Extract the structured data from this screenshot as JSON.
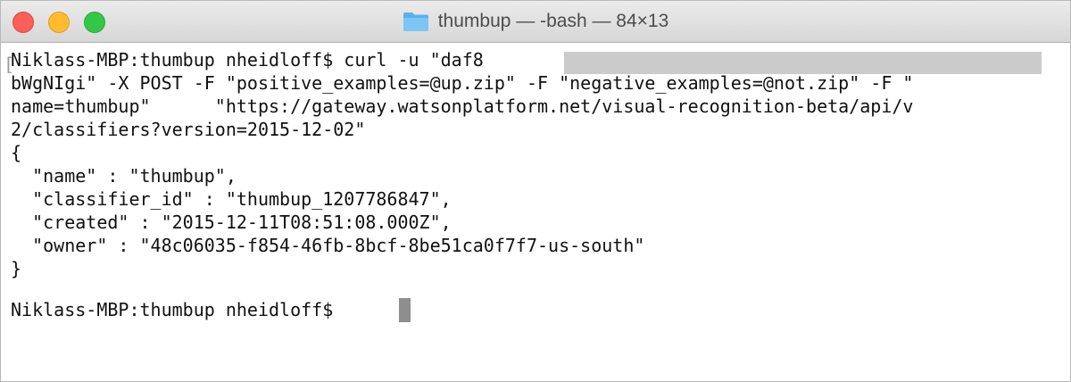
{
  "window": {
    "title": "thumbup — -bash — 84×13"
  },
  "icons": {
    "folder": "folder-icon",
    "close": "close-button",
    "minimize": "minimize-button",
    "zoom": "zoom-button"
  },
  "colors": {
    "close": "#fc5f57",
    "minimize": "#fdbc2e",
    "zoom": "#33c748",
    "folder": "#5ab1ea",
    "cursor": "#8e8e8e",
    "redaction": "#cbcbcb"
  },
  "terminal": {
    "lines": [
      "Niklass-MBP:thumbup nheidloff$ curl -u \"daf8                                                 _I",
      "bWgNIgi\" -X POST -F \"positive_examples=@up.zip\" -F \"negative_examples=@not.zip\" -F \"",
      "name=thumbup\"      \"https://gateway.watsonplatform.net/visual-recognition-beta/api/v",
      "2/classifiers?version=2015-12-02\"",
      "{",
      "  \"name\" : \"thumbup\",",
      "  \"classifier_id\" : \"thumbup_1207786847\",",
      "  \"created\" : \"2015-12-11T08:51:08.000Z\",",
      "  \"owner\" : \"48c06035-f854-46fb-8bcf-8be51ca0f7f7-us-south\"",
      "}",
      "Niklass-MBP:thumbup nheidloff$ "
    ]
  }
}
